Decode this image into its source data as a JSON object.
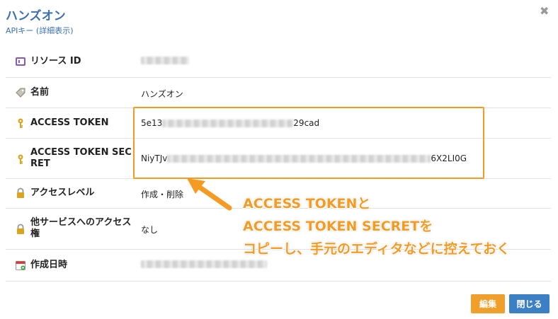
{
  "dialog": {
    "title": "ハンズオン",
    "subtitle": "APIキー (詳細表示)"
  },
  "fields": {
    "resource_id": {
      "label": "リソース ID",
      "icon": "id-card-icon"
    },
    "name": {
      "label": "名前",
      "value": "ハンズオン",
      "icon": "tag-icon"
    },
    "access_token": {
      "label": "ACCESS TOKEN",
      "value_prefix": "5e13",
      "value_suffix": "29cad",
      "icon": "key-icon"
    },
    "access_token_secret": {
      "label": "ACCESS TOKEN SECRET",
      "value_prefix": "NiyTJv",
      "value_suffix": "6X2LI0G",
      "icon": "key-icon"
    },
    "access_level": {
      "label": "アクセスレベル",
      "value": "作成・削除",
      "icon": "lock-icon"
    },
    "other_service_access": {
      "label": "他サービスへのアクセス権",
      "value": "なし",
      "icon": "lock-icon"
    },
    "created_at": {
      "label": "作成日時",
      "icon": "calendar-icon"
    }
  },
  "annotation": {
    "line1": "ACCESS TOKENと",
    "line2": "ACCESS TOKEN SECRETを",
    "line3": "コピーし、手元のエディタなどに控えておく",
    "color": "#f59a23"
  },
  "buttons": {
    "edit": "編集",
    "close": "閉じる"
  },
  "colors": {
    "title": "#3a6fb0",
    "edit_button": "#f0a02a",
    "close_button": "#3b7fc4"
  }
}
